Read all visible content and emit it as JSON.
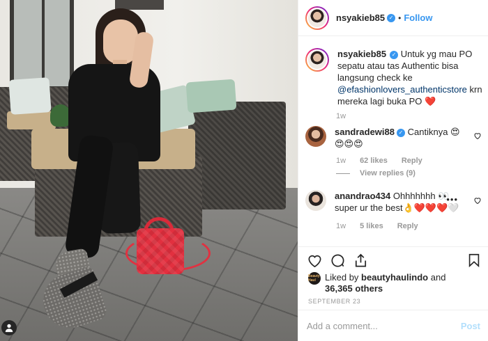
{
  "post": {
    "username": "nsyakieb85",
    "follow_label": "Follow",
    "header_dot": "•"
  },
  "caption": {
    "username": "nsyakieb85",
    "text_before": "Untuk yg mau PO sepatu atau tas Authentic bisa langsung check ke",
    "mention": "@efashionlovers_authenticstore",
    "text_after": "krn mereka lagi buka PO",
    "emoji": "❤️",
    "time": "1w"
  },
  "comments": [
    {
      "username": "sandradewi88",
      "verified": true,
      "text": "Cantiknya 😍",
      "text_line2": "😍😍😍",
      "time": "1w",
      "likes": "62 likes",
      "reply_label": "Reply",
      "view_replies": "View replies (9)"
    },
    {
      "username": "anandrao434",
      "verified": false,
      "text": "Ohhhhhhh 👀",
      "text_line2": "super ur the best👌❤️❤️❤️🤍",
      "time": "1w",
      "likes": "5 likes",
      "reply_label": "Reply",
      "more": "•••"
    }
  ],
  "liked_by": {
    "prefix": "Liked by",
    "user": "beautyhaulindo",
    "connector": "and",
    "count": "36,365 others",
    "avatar_text": "Beauty Haul"
  },
  "date": "SEPTEMBER 23",
  "add_comment": {
    "placeholder": "Add a comment...",
    "post_label": "Post"
  },
  "icons": [
    "heart-icon",
    "comment-icon",
    "share-icon",
    "save-icon",
    "user-tag-icon",
    "more-icon",
    "verified-icon"
  ],
  "colors": {
    "link_blue": "#3897f0",
    "mention_blue": "#003569",
    "muted": "#999999",
    "post_disabled": "#b2dffc"
  }
}
